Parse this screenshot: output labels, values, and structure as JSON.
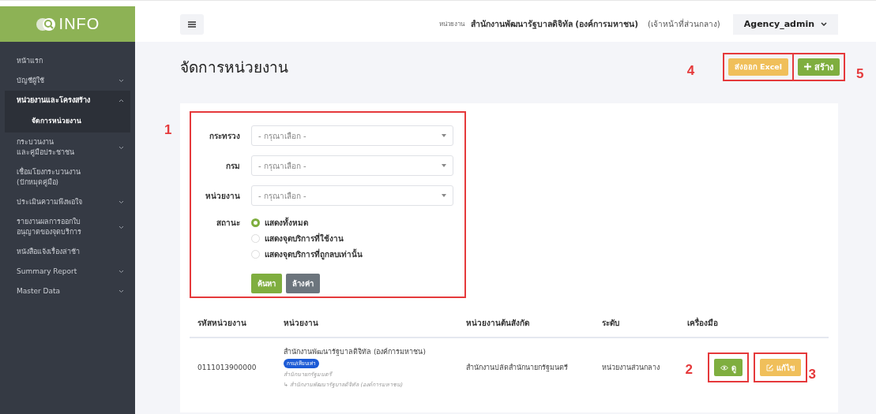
{
  "sidebar": {
    "logo": "INFO",
    "items": [
      {
        "lines": [
          "หน้าแรก"
        ],
        "expandable": false,
        "expanded": false
      },
      {
        "lines": [
          "บัญชีผู้ใช้"
        ],
        "expandable": true,
        "expanded": false
      },
      {
        "lines": [
          "หน่วยงานและโครงสร้าง"
        ],
        "expandable": true,
        "expanded": true,
        "children": [
          {
            "label": "จัดการหน่วยงาน",
            "selected": true
          }
        ]
      },
      {
        "lines": [
          "กระบวนงาน",
          "และคู่มือประชาชน"
        ],
        "expandable": true,
        "expanded": false
      },
      {
        "lines": [
          "เชื่อมโยงกระบวนงาน",
          "(ปักหมุดคู่มือ)"
        ],
        "expandable": false,
        "expanded": false
      },
      {
        "lines": [
          "ประเมินความพึงพอใจ"
        ],
        "expandable": true,
        "expanded": false
      },
      {
        "lines": [
          "รายงานผลการออกใบ",
          "อนุญาตของจุดบริการ"
        ],
        "expandable": true,
        "expanded": false
      },
      {
        "lines": [
          "หนังสือแจ้งเรื่องล่าช้า"
        ],
        "expandable": false,
        "expanded": false
      },
      {
        "lines": [
          "Summary Report"
        ],
        "expandable": true,
        "expanded": false
      },
      {
        "lines": [
          "Master Data"
        ],
        "expandable": true,
        "expanded": false
      }
    ]
  },
  "topbar": {
    "unit_label": "หน่วยงาน",
    "unit_name": "สำนักงานพัฒนารัฐบาลดิจิทัล (องค์การมหาชน)",
    "role": "(เจ้าหน้าที่ส่วนกลาง)",
    "user": "Agency_admin"
  },
  "page": {
    "title": "จัดการหน่วยงาน",
    "export_button": "ส่งออก Excel",
    "create_button": "สร้าง"
  },
  "filter": {
    "fields": [
      {
        "label": "กระทรวง",
        "placeholder": "- กรุณาเลือก -"
      },
      {
        "label": "กรม",
        "placeholder": "- กรุณาเลือก -"
      },
      {
        "label": "หน่วยงาน",
        "placeholder": "- กรุณาเลือก -"
      }
    ],
    "status_label": "สถานะ",
    "options": [
      {
        "label": "แสดงทั้งหมด",
        "selected": true
      },
      {
        "label": "แสดงจุดบริการที่ใช้งาน",
        "selected": false
      },
      {
        "label": "แสดงจุดบริการที่ถูกลบเท่านั้น",
        "selected": false
      }
    ],
    "search_button": "ค้นหา",
    "clear_button": "ล้างค่า"
  },
  "table": {
    "columns": [
      "รหัสหน่วยงาน",
      "หน่วยงาน",
      "หน่วยงานต้นสังกัด",
      "ระดับ",
      "เครื่องมือ"
    ],
    "rows": [
      {
        "code": "0111013900000",
        "name": "สำนักงานพัฒนารัฐบาลดิจิทัล (องค์การมหาชน)",
        "tag": "กรม/เทียบเท่า",
        "ministry": "สำนักนายกรัฐมนตรี",
        "path": "↳ สำนักงานพัฒนารัฐบาลดิจิทัล (องค์การมหาชน)",
        "parent": "สำนักงานปลัดสำนักนายกรัฐมนตรี",
        "level": "หน่วยงานส่วนกลาง",
        "view_button": "ดู",
        "edit_button": "แก้ไข"
      }
    ]
  },
  "annotations": [
    "1",
    "2",
    "3",
    "4",
    "5"
  ]
}
